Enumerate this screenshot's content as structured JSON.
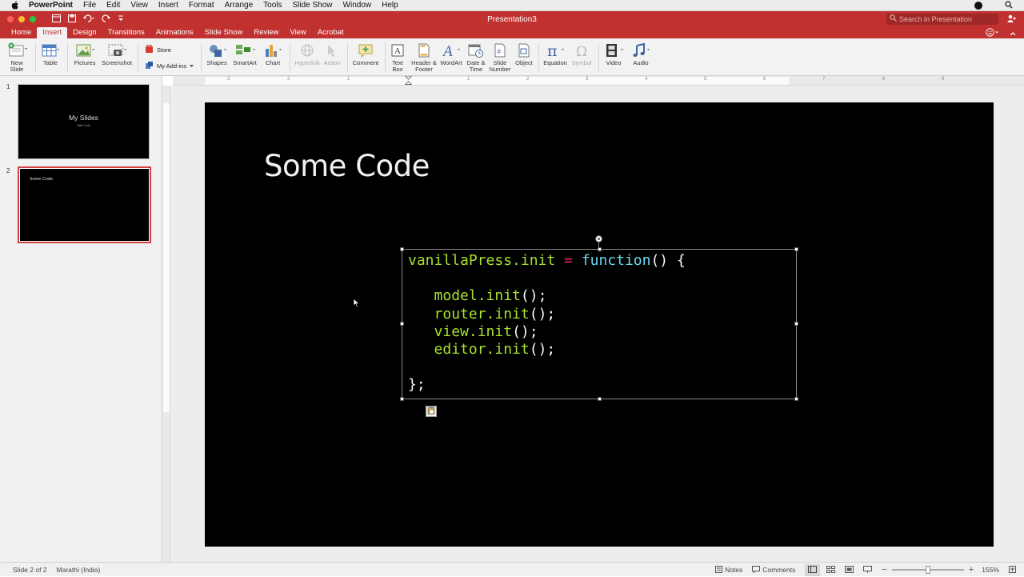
{
  "menubar": {
    "app_name": "PowerPoint",
    "items": [
      "File",
      "Edit",
      "View",
      "Insert",
      "Format",
      "Arrange",
      "Tools",
      "Slide Show",
      "Window",
      "Help"
    ]
  },
  "window": {
    "title": "Presentation3",
    "search_placeholder": "Search in Presentation"
  },
  "tabs": [
    "Home",
    "Insert",
    "Design",
    "Transitions",
    "Animations",
    "Slide Show",
    "Review",
    "View",
    "Acrobat"
  ],
  "active_tab": "Insert",
  "ribbon": {
    "new_slide": "New\nSlide",
    "table": "Table",
    "pictures": "Pictures",
    "screenshot": "Screenshot",
    "store": "Store",
    "my_addins": "My Add-ins",
    "shapes": "Shapes",
    "smartart": "SmartArt",
    "chart": "Chart",
    "hyperlink": "Hyperlink",
    "action": "Action",
    "comment": "Comment",
    "text_box_l1": "Text",
    "text_box_l2": "Box",
    "header_footer_l1": "Header &",
    "header_footer_l2": "Footer",
    "wordart": "WordArt",
    "date_time_l1": "Date &",
    "date_time_l2": "Time",
    "slide_number_l1": "Slide",
    "slide_number_l2": "Number",
    "object": "Object",
    "equation": "Equation",
    "symbol": "Symbol",
    "video": "Video",
    "audio": "Audio"
  },
  "ruler": {
    "h_numbers": [
      "3",
      "2",
      "1",
      "1",
      "2",
      "3",
      "4",
      "5",
      "6",
      "7",
      "8",
      "9"
    ]
  },
  "thumbnails": [
    {
      "number": "1",
      "title": "My Slides",
      "subtitle": "With Code"
    },
    {
      "number": "2",
      "title": "Some Code"
    }
  ],
  "slide": {
    "title": "Some Code",
    "code": {
      "l1_obj": "vanillaPress.init",
      "l1_eq": "=",
      "l1_fn": "function",
      "l1_rest": "() {",
      "l3": "model.init",
      "l4": "router.init",
      "l5": "view.init",
      "l6": "editor.init",
      "call": "();",
      "close": "};"
    }
  },
  "statusbar": {
    "slide_info": "Slide 2 of 2",
    "language": "Marathi (India)",
    "notes": "Notes",
    "comments": "Comments",
    "zoom": "155%"
  },
  "colors": {
    "brand": "#c0312f",
    "code_green": "#a6e22e",
    "code_pink": "#f92672",
    "code_cyan": "#66d9ef"
  }
}
